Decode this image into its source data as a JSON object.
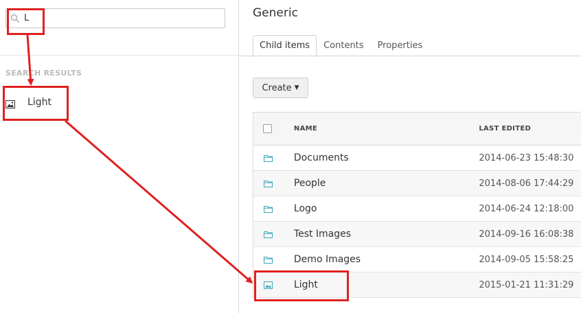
{
  "search": {
    "value": "L"
  },
  "left": {
    "results_title": "SEARCH RESULTS",
    "results": [
      {
        "label": "Light",
        "icon": "image-icon"
      }
    ]
  },
  "main": {
    "title": "Generic",
    "tabs": [
      {
        "label": "Child items",
        "active": true
      },
      {
        "label": "Contents",
        "active": false
      },
      {
        "label": "Properties",
        "active": false
      }
    ],
    "create_label": "Create",
    "columns": {
      "name": "NAME",
      "last_edited": "LAST EDITED"
    },
    "rows": [
      {
        "icon": "folder-icon",
        "name": "Documents",
        "date": "2014-06-23 15:48:30"
      },
      {
        "icon": "folder-icon",
        "name": "People",
        "date": "2014-08-06 17:44:29"
      },
      {
        "icon": "folder-icon",
        "name": "Logo",
        "date": "2014-06-24 12:18:00"
      },
      {
        "icon": "folder-icon",
        "name": "Test Images",
        "date": "2014-09-16 16:08:38"
      },
      {
        "icon": "folder-icon",
        "name": "Demo Images",
        "date": "2014-09-05 15:58:25"
      },
      {
        "icon": "image-icon",
        "name": "Light",
        "date": "2015-01-21 11:31:29"
      }
    ]
  },
  "colors": {
    "accent": "#3aa6b9",
    "annotation": "#e02020"
  }
}
